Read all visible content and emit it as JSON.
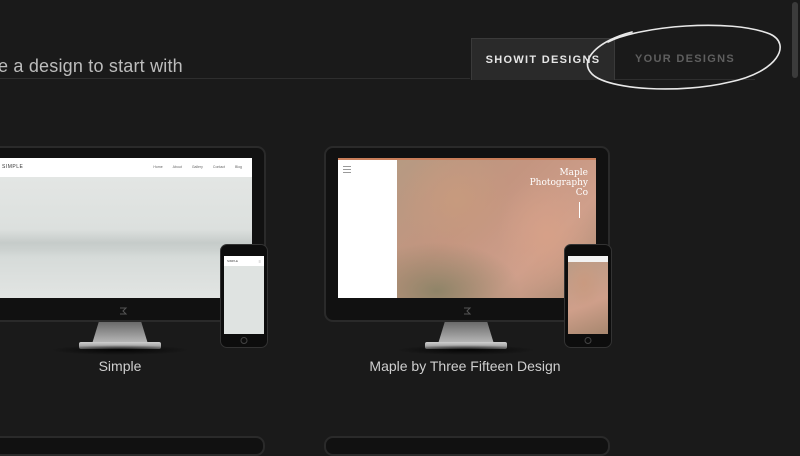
{
  "header": {
    "heading": "e a design to start with",
    "tabs": [
      {
        "label": "SHOWIT DESIGNS",
        "active": true
      },
      {
        "label": "YOUR DESIGNS",
        "active": false
      }
    ]
  },
  "annotation": {
    "shape": "hand-drawn ellipse",
    "color": "#e8e8e8",
    "target": "YOUR DESIGNS tab"
  },
  "designs": [
    {
      "title": "Simple",
      "preview": {
        "logo": "SIMPLE",
        "nav_links": [
          "Home",
          "About",
          "Gallery",
          "Contact",
          "Blog"
        ],
        "mobile_logo": "SIMPLE"
      }
    },
    {
      "title": "Maple by Three Fifteen Design",
      "preview": {
        "brand_lines": [
          "Maple",
          "Photography",
          "Co"
        ]
      }
    }
  ],
  "colors": {
    "background": "#1a1a1a",
    "active_tab": "#2a2a2a",
    "text": "#cfcfcf",
    "accent_line": "#c97e5a"
  }
}
